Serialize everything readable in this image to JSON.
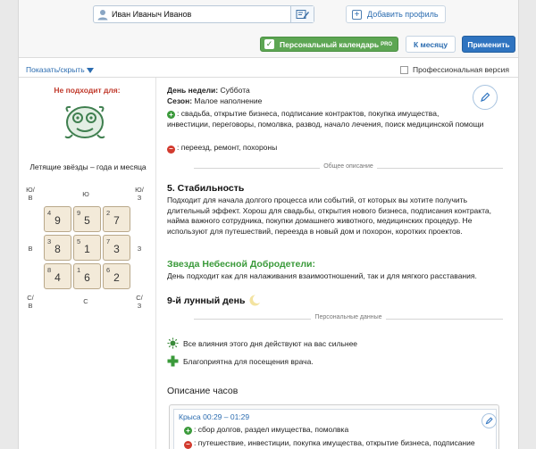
{
  "header": {
    "name_value": "Иван Иваныч Иванов",
    "add_profile_label": "Добавить профиль",
    "calendar_label": "Персональный календарь",
    "calendar_badge": "PRO",
    "month_label": "К месяцу",
    "apply_label": "Применить"
  },
  "options": {
    "toggle_label": "Показать/скрыть",
    "pro_version_label": "Профессиональная версия",
    "pro_version_checked": false
  },
  "left": {
    "not_suitable_label": "Не подходит для:",
    "emblem_icon": "monkey-emblem-icon",
    "stars_title": "Летящие звёзды – года и месяца",
    "directions": {
      "nw": "Ю/ В",
      "n": "Ю",
      "ne": "Ю/ З",
      "w": "В",
      "e": "З",
      "sw": "С/ В",
      "s": "С",
      "se": "С/ З"
    },
    "grid": [
      {
        "small": "4",
        "big": "9"
      },
      {
        "small": "9",
        "big": "5"
      },
      {
        "small": "2",
        "big": "7"
      },
      {
        "small": "3",
        "big": "8"
      },
      {
        "small": "5",
        "big": "1"
      },
      {
        "small": "7",
        "big": "3"
      },
      {
        "small": "8",
        "big": "4"
      },
      {
        "small": "1",
        "big": "6"
      },
      {
        "small": "6",
        "big": "2"
      }
    ]
  },
  "day": {
    "weekday_label": "День недели:",
    "weekday": "Суббота",
    "season_label": "Сезон:",
    "season": "Малое наполнение",
    "good_line1": ": свадьба, открытие бизнеса, подписание контрактов, покупка имущества,",
    "good_line2": "инвестиции, переговоры, помолвка, развод, начало лечения, поиск медицинской помощи",
    "bad_line": ": переезд, ремонт, похороны"
  },
  "dividers": {
    "general": "Общее описание",
    "personal": "Персональные данные"
  },
  "stability": {
    "title": "5. Стабильность",
    "text": "Подходит для начала долгого процесса или событий, от которых вы хотите получить длительный эффект. Хорош для свадьбы, открытия нового бизнеса, подписания контракта, найма важного сотрудника, покупки домашнего животного, медицинских процедур. Не используют для путешествий, переезда в новый дом и похорон, коротких проектов."
  },
  "star": {
    "title": "Звезда Небесной Добродетели:",
    "text": "День подходит как для налаживания взаимоотношений, так и для мягкого расставания."
  },
  "lunar": {
    "title": "9-й лунный день"
  },
  "personal": {
    "influence": "Все влияния этого дня действуют на вас сильнее",
    "doctor": "Благоприятна для посещения врача."
  },
  "hours": {
    "title": "Описание часов",
    "items": [
      {
        "name": "Крыса 00:29 – 01:29",
        "good": ": сбор долгов, раздел имущества, помолвка",
        "bad": ": путешествие, инвестиции, покупка имущества, открытие бизнеса, подписание"
      }
    ]
  },
  "colors": {
    "accent_blue": "#2f74c0",
    "calendar_green": "#5da653",
    "warning_red": "#c0392b",
    "star_green": "#3a9a3a"
  }
}
